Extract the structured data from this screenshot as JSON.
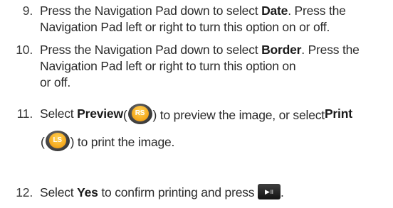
{
  "steps": [
    {
      "num": "9.",
      "line1_pre": "Press the Navigation Pad down to select ",
      "line1_bold": "Date",
      "line1_post": ". Press the",
      "line2": "Navigation Pad left or right to turn this option on or off."
    },
    {
      "num": "10.",
      "line1_pre": "Press the Navigation Pad down to select ",
      "line1_bold": "Border",
      "line1_post": ". Press the",
      "line2": "Navigation Pad left or right to turn this option on",
      "line3": "or off."
    },
    {
      "num": "11.",
      "pre": "Select ",
      "bold1": "Preview",
      "paren_open": " (",
      "key1": "RS",
      "mid": ") to preview the image, or select ",
      "bold2": "Print",
      "line2_open": "(",
      "key2": "LS",
      "line2_post": ") to print the image."
    },
    {
      "num": "12.",
      "pre": "Select ",
      "bold": "Yes",
      "post": " to confirm printing and press ",
      "key_glyph": "▶॥",
      "end": "."
    }
  ],
  "icons": {
    "rs_key": "rs-soft-key-icon",
    "ls_key": "ls-soft-key-icon",
    "play_pause": "play-pause-key-icon"
  },
  "colors": {
    "key_face": "#f6ad22",
    "text": "#2b2b2b"
  }
}
